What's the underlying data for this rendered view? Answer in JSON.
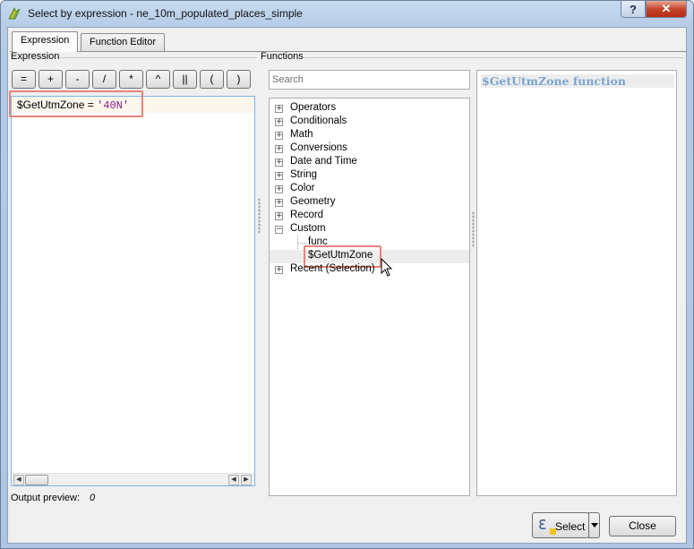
{
  "window": {
    "title": "Select by expression - ne_10m_populated_places_simple",
    "help_button": "?",
    "close_button": "✕"
  },
  "tabs": [
    {
      "label": "Expression",
      "active": true
    },
    {
      "label": "Function Editor",
      "active": false
    }
  ],
  "expression_section_label": "Expression",
  "functions_section_label": "Functions",
  "operators": [
    "=",
    "+",
    "-",
    "/",
    "*",
    "^",
    "||",
    "(",
    ")"
  ],
  "editor": {
    "function_token": "$GetUtmZone",
    "operator_token": " = ",
    "string_token": "'40N'"
  },
  "output_preview": {
    "label": "Output preview:",
    "value": "0"
  },
  "search": {
    "placeholder": "Search"
  },
  "function_tree": {
    "groups": [
      {
        "label": "Operators",
        "expander": "+"
      },
      {
        "label": "Conditionals",
        "expander": "+"
      },
      {
        "label": "Math",
        "expander": "+"
      },
      {
        "label": "Conversions",
        "expander": "+"
      },
      {
        "label": "Date and Time",
        "expander": "+"
      },
      {
        "label": "String",
        "expander": "+"
      },
      {
        "label": "Color",
        "expander": "+"
      },
      {
        "label": "Geometry",
        "expander": "+"
      },
      {
        "label": "Record",
        "expander": "+"
      },
      {
        "label": "Custom",
        "expander": "−"
      }
    ],
    "custom_children": [
      "func",
      "$GetUtmZone"
    ],
    "recent": {
      "label": "Recent (Selection)",
      "expander": "+"
    }
  },
  "help_panel": {
    "title": "$GetUtmZone function"
  },
  "buttons": {
    "select_label": "Select",
    "close_label": "Close"
  },
  "colors": {
    "highlight_box": "#e8837b",
    "help_title": "#7ba4d1",
    "string_literal": "#8b1a8b"
  }
}
